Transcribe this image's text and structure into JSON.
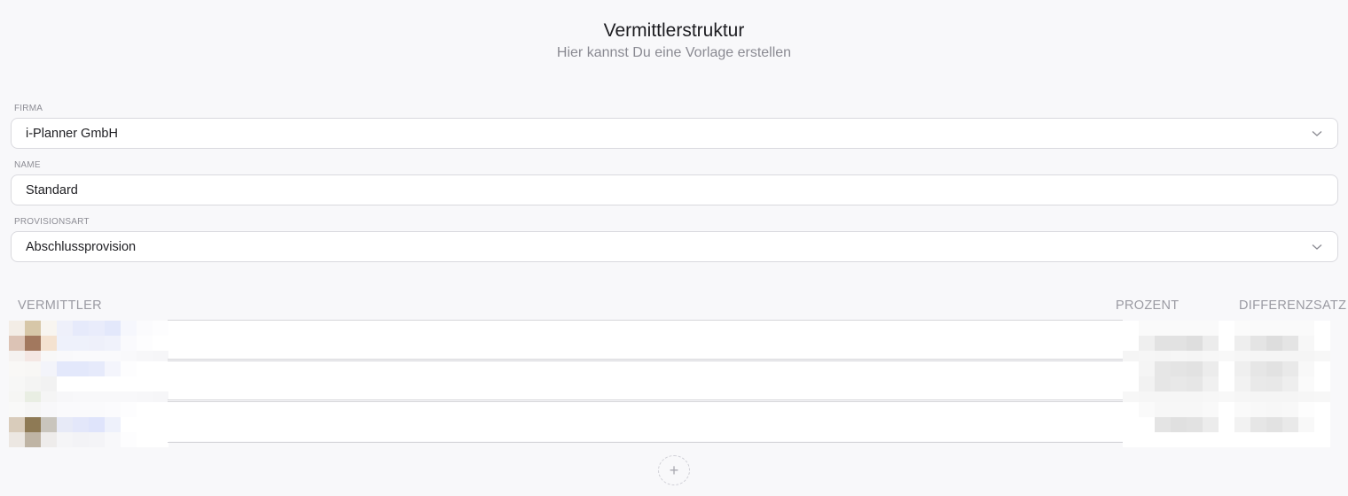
{
  "header": {
    "title": "Vermittlerstruktur",
    "subtitle": "Hier kannst Du eine Vorlage erstellen"
  },
  "form": {
    "firma": {
      "label": "FIRMA",
      "value": "i-Planner GmbH",
      "icon": "chevron-down-icon"
    },
    "name": {
      "label": "NAME",
      "value": "Standard"
    },
    "provisionsart": {
      "label": "PROVISIONSART",
      "value": "Abschlussprovision",
      "icon": "chevron-down-icon"
    }
  },
  "table": {
    "columns": [
      "VERMITTLER",
      "PROZENT",
      "DIFFERENZSATZ"
    ],
    "rows_count_note": "3 rows with pixelated (obscured) content"
  },
  "actions": {
    "add_icon": "plus-icon",
    "add_glyph": "+"
  },
  "colors": {
    "background": "#f8f8fa",
    "border": "#d9d9de",
    "muted_text": "#8a8a92"
  }
}
